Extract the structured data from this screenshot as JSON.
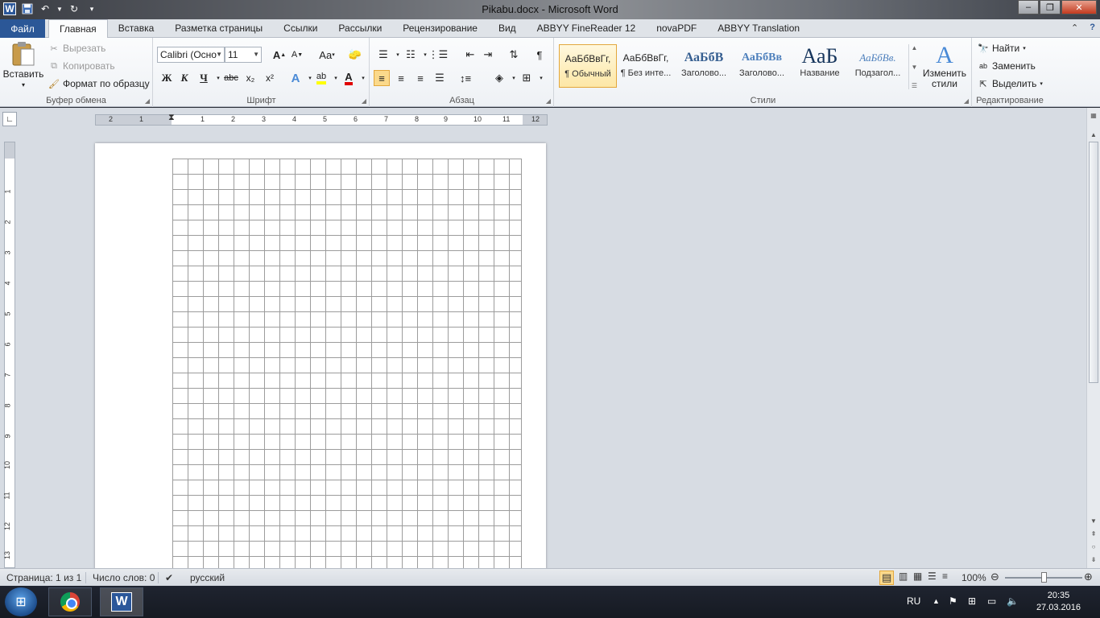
{
  "window": {
    "title": "Pikabu.docx - Microsoft Word",
    "logo_letter": "W"
  },
  "tabs": {
    "file": "Файл",
    "items": [
      "Главная",
      "Вставка",
      "Разметка страницы",
      "Ссылки",
      "Рассылки",
      "Рецензирование",
      "Вид",
      "ABBYY FineReader 12",
      "novaPDF",
      "ABBYY Translation"
    ],
    "active_index": 0
  },
  "clipboard": {
    "paste": "Вставить",
    "cut": "Вырезать",
    "copy": "Копировать",
    "format_painter": "Формат по образцу",
    "label": "Буфер обмена"
  },
  "font": {
    "name": "Calibri (Осно",
    "size": "11",
    "bold": "Ж",
    "italic": "К",
    "underline": "Ч",
    "strike": "abc",
    "subscript": "x₂",
    "superscript": "x²",
    "label": "Шрифт",
    "grow": "A",
    "shrink": "A",
    "case": "Aa"
  },
  "paragraph": {
    "label": "Абзац",
    "pilcrow": "¶"
  },
  "styles": {
    "label": "Стили",
    "items": [
      {
        "sample": "АаБбВвГг,",
        "name": "¶ Обычный"
      },
      {
        "sample": "АаБбВвГг,",
        "name": "¶ Без инте..."
      },
      {
        "sample": "АаБбВ",
        "name": "Заголово..."
      },
      {
        "sample": "АаБбВв",
        "name": "Заголово..."
      },
      {
        "sample": "АаБ",
        "name": "Название"
      },
      {
        "sample": "АаБбВв.",
        "name": "Подзагол..."
      }
    ],
    "change_styles": "Изменить стили"
  },
  "editing": {
    "label": "Редактирование",
    "find": "Найти",
    "replace": "Заменить",
    "select": "Выделить"
  },
  "ruler": {
    "h_numbers": [
      "2",
      "1",
      "1",
      "2",
      "3",
      "4",
      "5",
      "6",
      "7",
      "8",
      "9",
      "10",
      "11",
      "12"
    ],
    "v_numbers": [
      "1",
      "2",
      "3",
      "4",
      "5",
      "6",
      "7",
      "8",
      "9",
      "10",
      "11",
      "12",
      "13"
    ]
  },
  "statusbar": {
    "page": "Страница: 1 из 1",
    "words": "Число слов: 0",
    "language": "русский",
    "zoom": "100%",
    "zoom_percent": 100
  },
  "taskbar": {
    "lang": "RU",
    "time": "20:35",
    "date": "27.03.2016"
  },
  "colors": {
    "file_tab": "#2b5797",
    "highlight": "#ffff00",
    "font_color": "#e00000",
    "active_btn": "#fbd98b"
  }
}
